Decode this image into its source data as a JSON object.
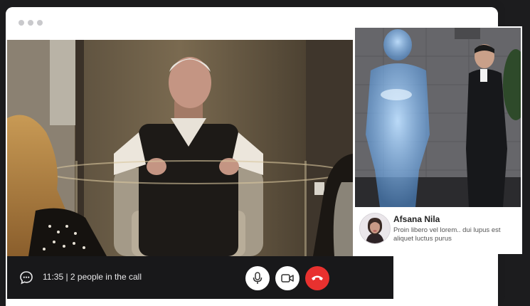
{
  "call": {
    "status_text": "11:35 | 2 people in the call"
  },
  "caller": {
    "name": "Afsana Nila",
    "message": "Proin libero vel lorem.. dui lupus est aliquet luctus purus"
  },
  "controls": [
    {
      "name": "microphone",
      "icon": "microphone-icon",
      "bg": "#ffffff"
    },
    {
      "name": "camera",
      "icon": "video-camera-icon",
      "bg": "#ffffff"
    },
    {
      "name": "end-call",
      "icon": "phone-hangup-icon",
      "bg": "#e8312f"
    }
  ],
  "icons": {
    "chat": "chat-bubble-icon"
  },
  "colors": {
    "end_call": "#e8312f",
    "call_bar": "#18181a",
    "frame": "#1b1b1d"
  }
}
